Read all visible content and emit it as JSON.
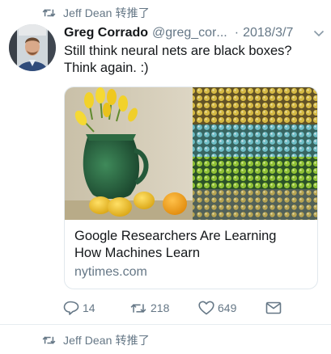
{
  "top_retweet": {
    "text": "Jeff Dean 转推了"
  },
  "tweet": {
    "author_name": "Greg Corrado",
    "author_handle": "@greg_cor",
    "handle_ellipsis": "...",
    "separator": "·",
    "date": "2018/3/7",
    "text_line1": "Still think neural nets are black boxes?",
    "text_line2": "Think again.  :)"
  },
  "card": {
    "title_line1": "Google Researchers Are Learning",
    "title_line2": "How Machines Learn",
    "domain": "nytimes.com",
    "image_left": "still-life-vase-lemons",
    "image_right": "neural-feature-visualization-grid"
  },
  "actions": {
    "reply_count": "14",
    "retweet_count": "218",
    "like_count": "649"
  },
  "bottom_retweet": {
    "text": "Jeff Dean 转推了"
  },
  "icons": [
    "retweet-icon",
    "chevron-down-icon",
    "reply-icon",
    "like-icon",
    "dm-icon"
  ],
  "colors": {
    "secondary_text": "#657786",
    "primary_text": "#14171a",
    "border": "#e1e8ed"
  }
}
